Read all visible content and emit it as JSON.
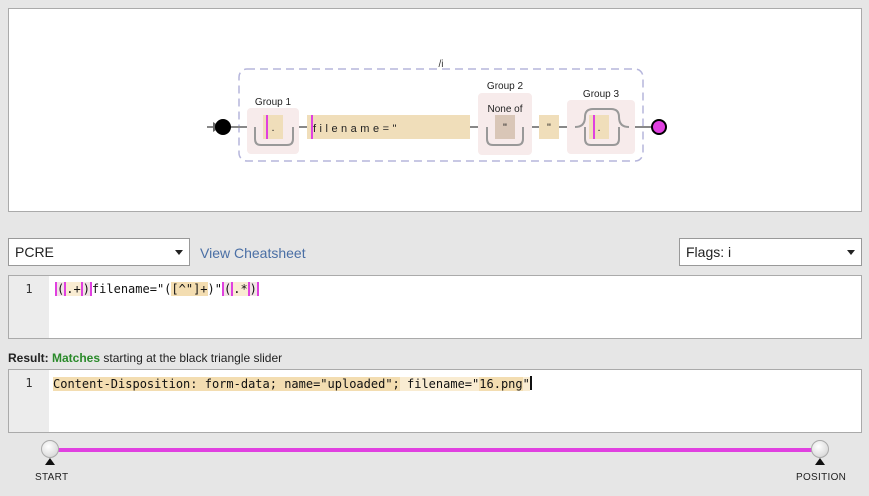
{
  "diagram": {
    "flag_label": "/i",
    "group1_label": "Group 1",
    "group2_label": "Group 2",
    "group2_sub": "None of",
    "group3_label": "Group 3",
    "dot": ".",
    "literal_text": "filename=\"",
    "quote_char": "\"",
    "quote_literal": "\""
  },
  "controls": {
    "flavor_value": "PCRE",
    "cheatsheet_link": "View Cheatsheet",
    "flags_value": "Flags: i"
  },
  "regex_editor": {
    "line_number": "1",
    "tokens": [
      "(",
      ".+",
      ")",
      "filename=\"(",
      "[^\"]+",
      ")\"",
      "(",
      ".*",
      ")"
    ]
  },
  "result": {
    "label": "Result:",
    "status": "Matches",
    "detail": "starting at the black triangle slider"
  },
  "test_editor": {
    "line_number": "1",
    "match_part1": "Content-Disposition: form-data; name=\"uploaded\";",
    "match_part2": " filename=\"",
    "match_part3": "16.png",
    "match_part4": "\""
  },
  "slider": {
    "start_label": "START",
    "position_label": "POSITION",
    "start_fraction": 0,
    "position_fraction": 1
  },
  "colors": {
    "group_highlight": "#e040e0",
    "literal_fill": "#f0deba",
    "group_fill": "#f7ebeb",
    "match_green": "#2a8a2a",
    "link_blue": "#4a6fa5"
  }
}
